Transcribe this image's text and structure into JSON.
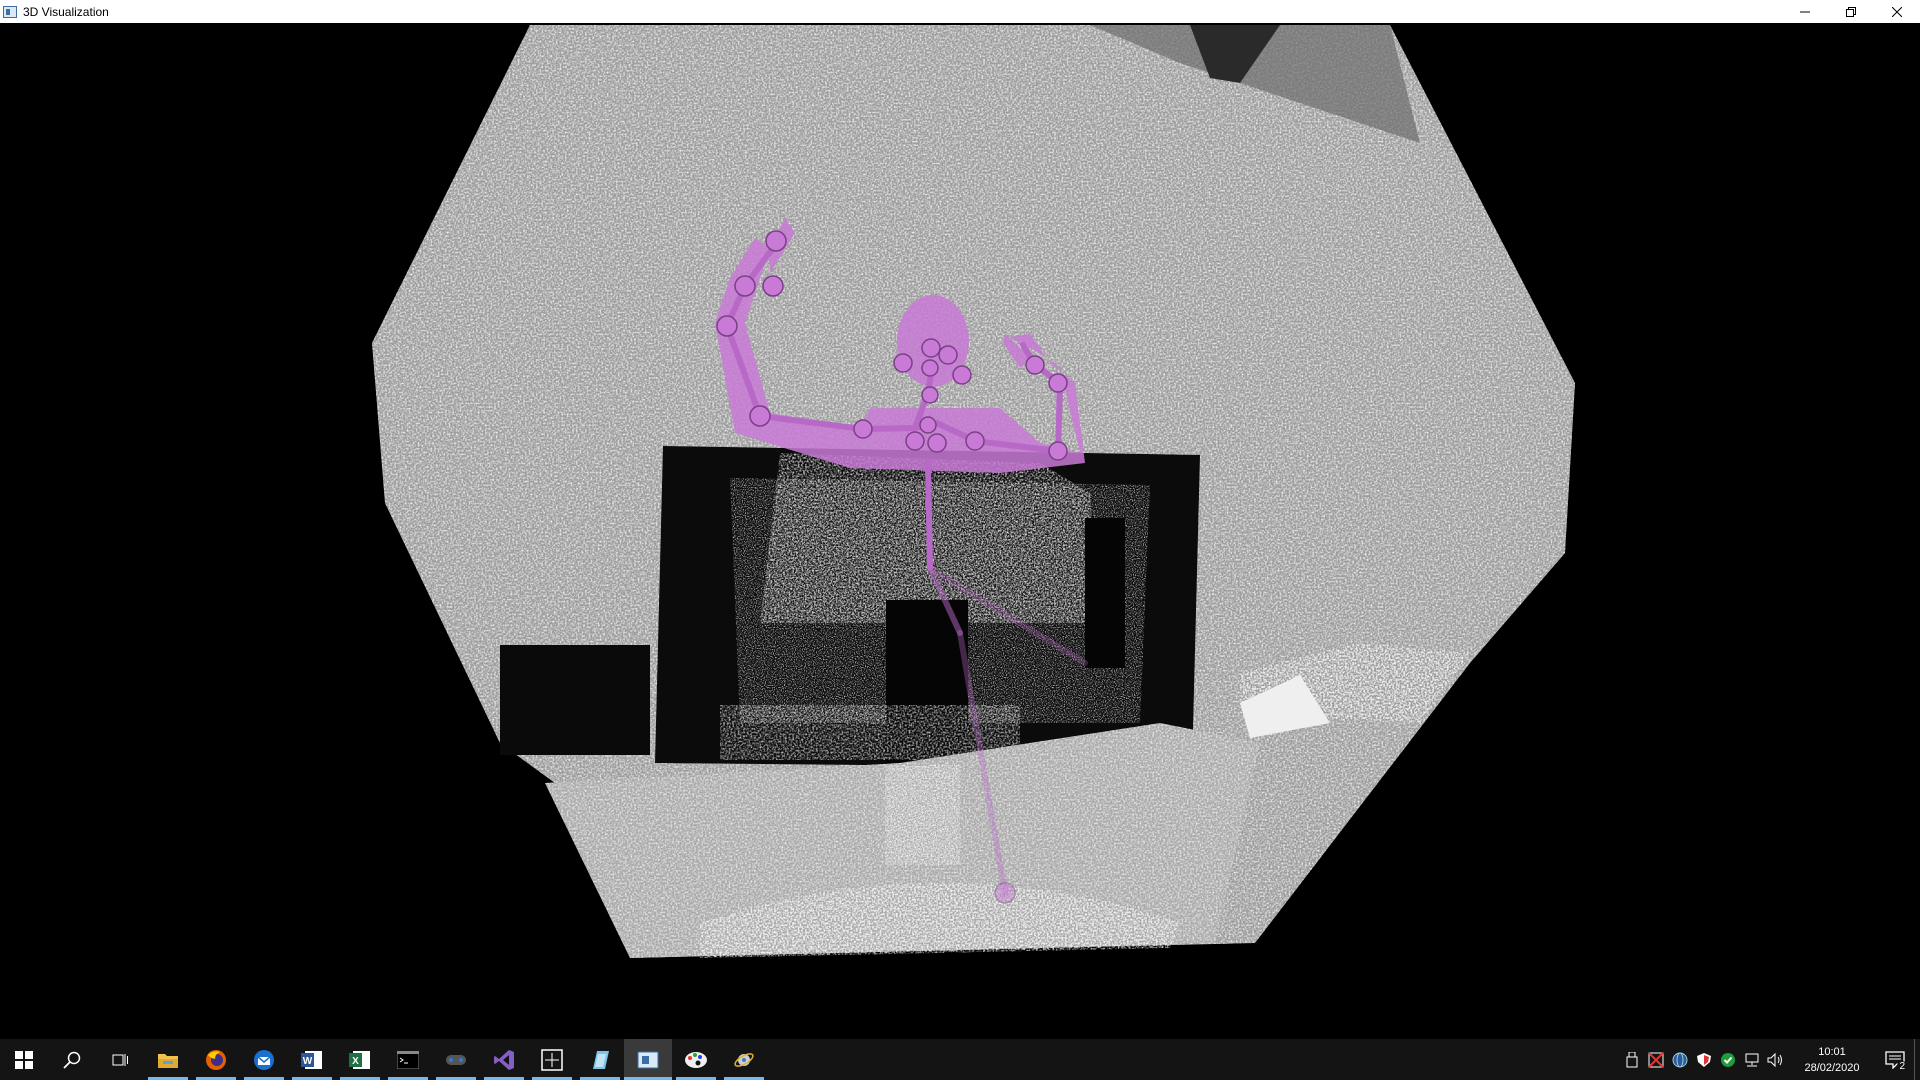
{
  "window": {
    "title": "3D Visualization",
    "icon": "app-window-icon",
    "controls": [
      "minimize-icon",
      "restore-icon",
      "close-icon"
    ]
  },
  "viewport": {
    "content": "point-cloud-with-skeleton-overlay",
    "point_color": "#d8d8d8",
    "skeleton_color": "#c87ad6",
    "background": "#000000"
  },
  "taskbar": {
    "apps": [
      {
        "name": "start-icon",
        "active": false
      },
      {
        "name": "search-icon",
        "active": false
      },
      {
        "name": "task-view-icon",
        "active": false
      },
      {
        "name": "file-explorer-icon",
        "active": true
      },
      {
        "name": "firefox-icon",
        "active": true
      },
      {
        "name": "thunderbird-icon",
        "active": true
      },
      {
        "name": "word-icon",
        "active": true
      },
      {
        "name": "excel-icon",
        "active": true
      },
      {
        "name": "terminal-icon",
        "active": true
      },
      {
        "name": "gamepad-icon",
        "active": true
      },
      {
        "name": "visual-studio-icon",
        "active": true
      },
      {
        "name": "snipping-tool-icon",
        "active": true
      },
      {
        "name": "note-app-icon",
        "active": true
      },
      {
        "name": "3d-visualization-icon",
        "active": true,
        "current": true
      },
      {
        "name": "paint-icon",
        "active": true
      },
      {
        "name": "orbit-app-icon",
        "active": true
      }
    ],
    "tray_icons": [
      "usb-icon",
      "power-mgmt-icon",
      "network-globe-icon",
      "shield-icon",
      "defender-check-icon",
      "network-icon",
      "volume-icon"
    ],
    "time": "10:01",
    "date": "28/02/2020",
    "notification_count": "2"
  }
}
